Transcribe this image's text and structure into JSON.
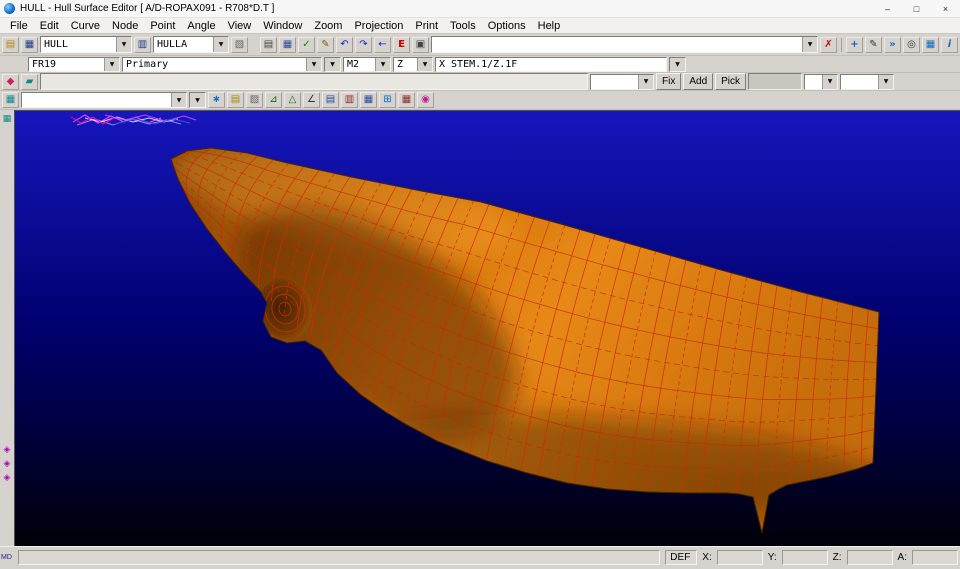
{
  "window": {
    "title": "HULL - Hull Surface Editor [ A/D-ROPAX091 - R708*D.T ]",
    "controls": {
      "minimize": "–",
      "maximize": "□",
      "close": "×"
    }
  },
  "menu": {
    "items": [
      "File",
      "Edit",
      "Curve",
      "Node",
      "Point",
      "Angle",
      "View",
      "Window",
      "Zoom",
      "Projection",
      "Print",
      "Tools",
      "Options",
      "Help"
    ]
  },
  "icons": {
    "dropdown": "▼",
    "open_folder": "▤",
    "save_disk": "▦",
    "save_note": "▥",
    "doc_page": "▧",
    "sheet_a": "▤",
    "sheet_b": "▦",
    "check_page": "✓",
    "edit_page": "✎",
    "undo": "↶",
    "redo": "↷",
    "arrow_left": "←",
    "error_marker": "E",
    "window_panel": "▣",
    "delete_cross": "✗",
    "fit_cross": "+",
    "draw_pen": "✎",
    "fast_chevrons": "»",
    "target_scope": "◎",
    "table_panel": "▦",
    "info_badge": "i",
    "node_diamond": "◆",
    "segment_bars": "▰",
    "display_grid": "▦",
    "star_snap": "∗",
    "layer_sheet": "▤",
    "hatch_square": "▨",
    "tri_small": "⊿",
    "triangle": "△",
    "angle_mark": "∠",
    "page_lines": "▤",
    "page_marks": "▥",
    "table_e": "▦",
    "grid_plus": "⊞",
    "calendar_grid": "▦",
    "palette_dot": "◉",
    "strip_grid": "▦",
    "marker_1": "◈",
    "marker_2": "◈",
    "marker_3": "◈"
  },
  "toolbar1": {
    "hull": "HULL",
    "hulla": "HULLA",
    "path_value": ""
  },
  "toolbar2": {
    "frame": "FR19",
    "mode": "Primary",
    "blank": "",
    "m": "M2",
    "axis": "Z",
    "expr": "X STEM.1/Z.1F"
  },
  "toolbar3": {
    "field": "",
    "fix": "Fix",
    "add": "Add",
    "pick": "Pick"
  },
  "toolbar4": {
    "combo": ""
  },
  "left_strip": {
    "label": "MD"
  },
  "statusbar": {
    "mode": "DEF",
    "x": "X:",
    "y": "Y:",
    "z": "Z:",
    "a": "A:"
  }
}
